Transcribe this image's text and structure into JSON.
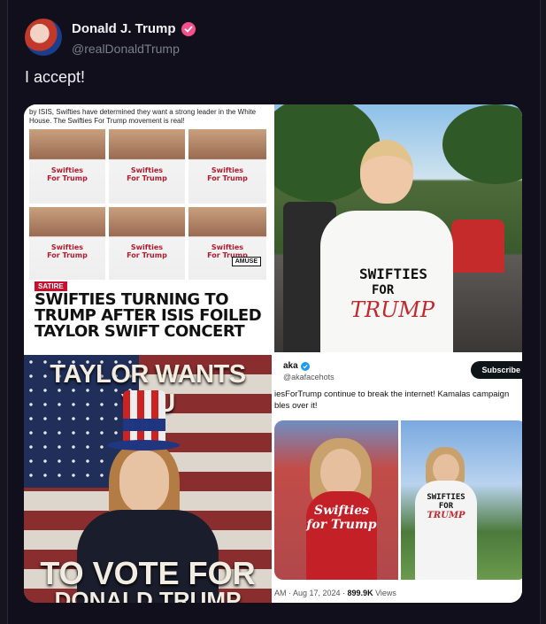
{
  "tweet": {
    "author_name": "Donald J. Trump",
    "handle": "@realDonaldTrump",
    "text": "I accept!"
  },
  "media": {
    "tile1": {
      "caption": "by ISIS, Swifties have determined they want a strong leader in the White House. The Swifties For Trump movement is real!",
      "satire_badge": "SATIRE",
      "headline": "SWIFTIES TURNING TO TRUMP AFTER ISIS FOILED TAYLOR SWIFT CONCERT",
      "watermark": "AMUSE",
      "shirt_text": "Swifties For Trump"
    },
    "tile2": {
      "shirt_line1": "SWIFTIES",
      "shirt_line2": "FOR",
      "shirt_line3": "TRUMP"
    },
    "tile3": {
      "title": "TAYLOR WANTS YOU",
      "line1": "TO VOTE FOR",
      "line2": "DONALD TRUMP"
    },
    "tile4": {
      "name": "aka",
      "handle": "@akafacehots",
      "subscribe_label": "Subscribe",
      "text": "iesForTrump continue to break the internet! Kamalas campaign bles over it!",
      "red_shirt_text": "Swifties for Trump",
      "white_shirt_line1": "SWIFTIES",
      "white_shirt_line2": "FOR",
      "white_shirt_line3": "TRUMP",
      "meta_time": "AM · Aug 17, 2024 · ",
      "meta_views_count": "899.9K",
      "meta_views_label": " Views"
    }
  },
  "colors": {
    "background": "#110f1c",
    "verified_badge": "#f5508b",
    "satire_red": "#c8102e"
  }
}
